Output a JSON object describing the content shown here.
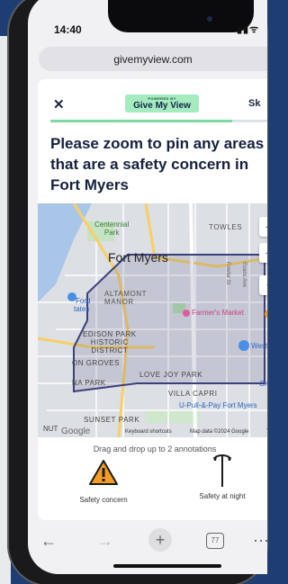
{
  "status_bar": {
    "time": "14:40",
    "icons": "..ll ᯤ"
  },
  "browser": {
    "url": "givemyview.com",
    "tab_count": "77"
  },
  "header": {
    "close_glyph": "✕",
    "badge_small": "POWERED BY",
    "badge_main": "Give My View",
    "skip": "Sk",
    "progress_fraction": 0.82
  },
  "question": {
    "title": "Please zoom to pin any areas that are a safety concern in Fort Myers"
  },
  "map": {
    "labels": {
      "centennial_park": "Centennial\nPark",
      "towles": "TOWLES",
      "fort_myers": "Fort Myers",
      "ford": "Ford",
      "states": "tates",
      "altamont": "ALTAMONT\nMANOR",
      "farmers_market": "Farmer's Market",
      "edison_park": "EDISON PARK\nHISTORIC\nDISTRICT",
      "western": "Westerr",
      "on_groves": "ON GROVES",
      "na_park": "NA PARK",
      "love_joy": "LOVE JOY PARK",
      "villa_capri": "VILLA CAPRI",
      "upull": "U-Pull-&-Pay Fort Myers",
      "sunset_park": "SUNSET PARK",
      "nut": "NUT",
      "fowler_st": "Fowler St",
      "evans_ave": "Evans Ave",
      "ck": "CK"
    },
    "attribution": {
      "google": "Google",
      "shortcuts": "Keyboard shortcuts",
      "map_data": "Map data ©2024 Google",
      "terms": "T"
    },
    "controls": {
      "zoom_in": "+",
      "zoom_out": "−"
    }
  },
  "annotations": {
    "hint": "Drag and drop up to 2 annotations",
    "items": [
      {
        "label": "Safety concern",
        "icon": "warning-triangle-icon"
      },
      {
        "label": "Safety at night",
        "icon": "street-lamp-icon"
      }
    ]
  },
  "toolbar": {
    "back": "←",
    "forward": "→",
    "new_tab": "+",
    "more": "⋯"
  },
  "colors": {
    "background": "#1e3e73",
    "badge_bg": "#a5ebbf",
    "title_text": "#16213e",
    "progress": "#7fd8a2",
    "polygon": "#3b3f7a",
    "warning": "#f29e25"
  }
}
